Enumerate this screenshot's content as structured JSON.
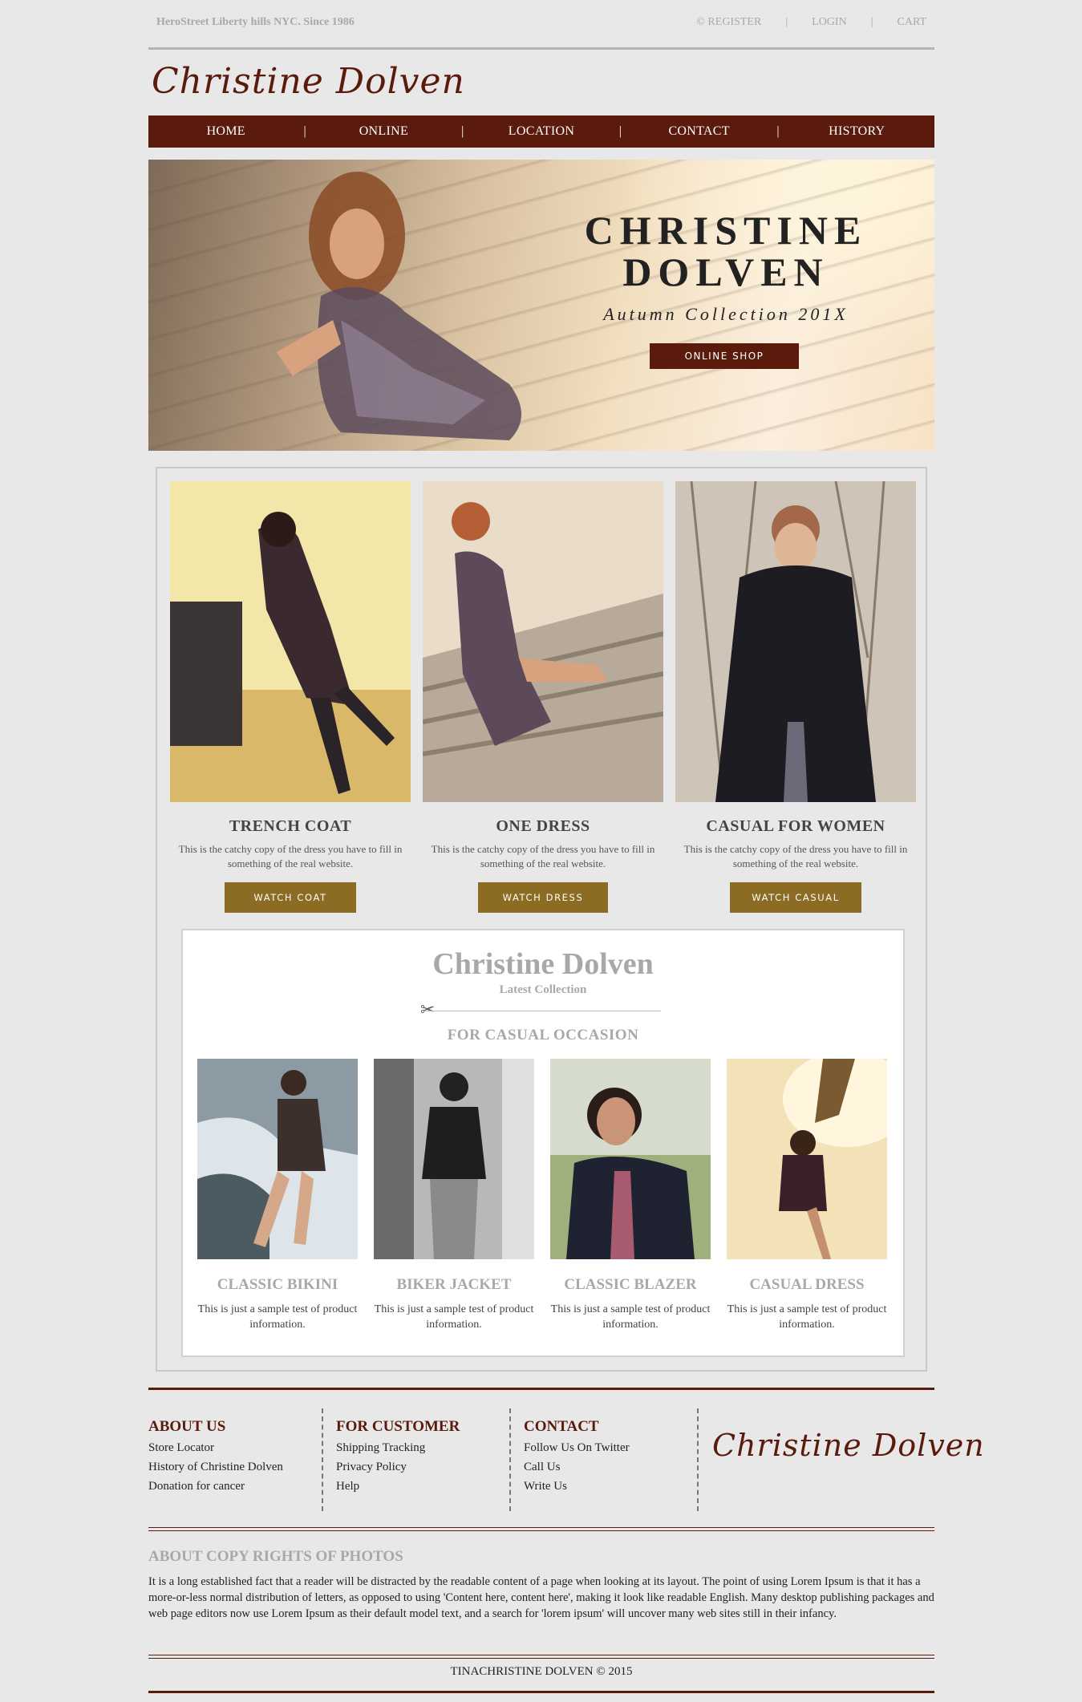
{
  "topbar": {
    "address": "HeroStreet Liberty hills NYC. Since 1986",
    "register": "© REGISTER",
    "login": "LOGIN",
    "cart": "CART",
    "separator": "|"
  },
  "brand": {
    "logo_text": "Christine Dolven"
  },
  "nav": {
    "items": [
      "HOME",
      "ONLINE",
      "LOCATION",
      "CONTACT",
      "HISTORY"
    ],
    "separator": "|"
  },
  "hero": {
    "title_line1": "CHRISTINE",
    "title_line2": "DOLVEN",
    "subtitle": "Autumn Collection 201X",
    "button": "ONLINE SHOP"
  },
  "features": [
    {
      "title": "TRENCH COAT",
      "description": "This is the catchy copy of the dress you have to fill in something of the real website.",
      "button": "WATCH COAT"
    },
    {
      "title": "ONE DRESS",
      "description": "This is the catchy copy of the dress you have to fill in something of the real website.",
      "button": "WATCH DRESS"
    },
    {
      "title": "CASUAL FOR WOMEN",
      "description": "This is the catchy copy of the dress you have to fill in something of the real website.",
      "button": "WATCH CASUAL"
    }
  ],
  "latest": {
    "title": "Christine Dolven",
    "subtitle": "Latest Collection",
    "scissors_icon": "✂",
    "occasion": "FOR CASUAL OCCASION",
    "products": [
      {
        "title": "CLASSIC BIKINI",
        "description": "This is just a sample test of product information."
      },
      {
        "title": "BIKER JACKET",
        "description": "This is just a sample test of product information."
      },
      {
        "title": "CLASSIC BLAZER",
        "description": "This is just a sample test of product information."
      },
      {
        "title": "CASUAL DRESS",
        "description": "This is just a sample test of product information."
      }
    ]
  },
  "footer": {
    "about": {
      "heading": "ABOUT US",
      "links": [
        "Store Locator",
        "History of Christine Dolven",
        "Donation for cancer"
      ]
    },
    "customer": {
      "heading": "FOR CUSTOMER",
      "links": [
        "Shipping Tracking",
        "Privacy Policy",
        "Help"
      ]
    },
    "contact": {
      "heading": "CONTACT",
      "links": [
        "Follow Us On Twitter",
        "Call Us",
        "Write Us"
      ]
    },
    "logo_text": "Christine Dolven",
    "copyright_heading": "ABOUT COPY RIGHTS OF PHOTOS",
    "copyright_text": "It is a long established fact that a reader will be distracted by the readable content of a page when looking at its layout. The point of using Lorem Ipsum is that it has a more-or-less normal distribution of letters, as opposed to using 'Content here, content here', making it look like readable English. Many desktop publishing packages and web page editors now use Lorem Ipsum as their default model text, and a search for 'lorem ipsum' will uncover many web sites still in their infancy.",
    "credit": "TINACHRISTINE DOLVEN © 2015"
  },
  "colors": {
    "brand": "#5a1a0c",
    "button_gold": "#8b6c22",
    "muted": "#a8a8a8",
    "background": "#e8e8e8"
  }
}
